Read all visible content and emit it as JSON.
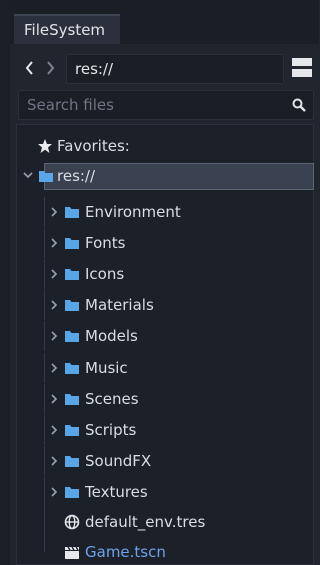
{
  "dock": {
    "tab_label": "FileSystem"
  },
  "path": {
    "value": "res://",
    "back_icon": "chevron-left-icon",
    "forward_icon": "chevron-right-icon",
    "split_icon": "split-mode-icon"
  },
  "search": {
    "placeholder": "Search files",
    "icon": "search-icon"
  },
  "tree": {
    "favorites_label": "Favorites:",
    "root_label": "res://",
    "folders": [
      "Environment",
      "Fonts",
      "Icons",
      "Materials",
      "Models",
      "Music",
      "Scenes",
      "Scripts",
      "SoundFX",
      "Textures"
    ],
    "files": [
      {
        "name": "default_env.tres",
        "icon": "globe-icon"
      },
      {
        "name": "Game.tscn",
        "icon": "clapperboard-icon"
      }
    ]
  },
  "colors": {
    "folder": "#58a6e8",
    "scene_file_text": "#6ea3ea",
    "selection": "#3a4150"
  }
}
